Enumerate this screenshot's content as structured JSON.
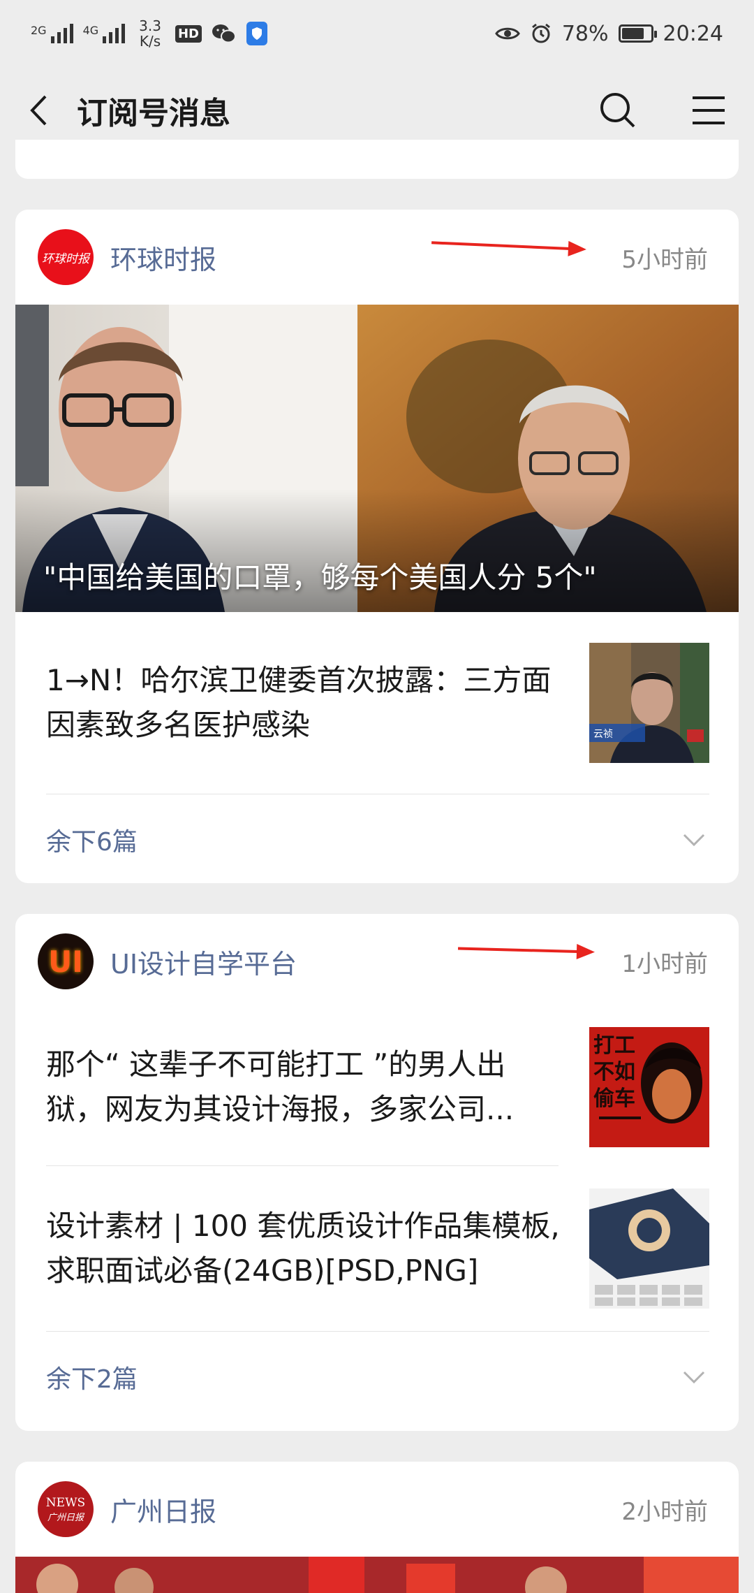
{
  "status_bar": {
    "network1": "2G",
    "network2": "4G",
    "speed_value": "3.3",
    "speed_unit": "K/s",
    "hd": "HD",
    "battery_percent": "78%",
    "battery_level": 0.78,
    "time": "20:24"
  },
  "nav": {
    "title": "订阅号消息"
  },
  "cards": [
    {
      "source": "环球时报",
      "logo_text": "环球时报",
      "time": "5小时前",
      "hero_caption": "\"中国给美国的口罩，够每个美国人分 5个\"",
      "articles": [
        {
          "title": "1→N！哈尔滨卫健委首次披露：三方面因素致多名医护感染",
          "thumb_caption": "云祯"
        }
      ],
      "more": "余下6篇"
    },
    {
      "source": "UI设计自学平台",
      "logo_text": "UI",
      "time": "1小时前",
      "articles": [
        {
          "title": "那个“ 这辈子不可能打工 ”的男人出狱，网友为其设计海报，多家公司...",
          "thumb_caption": "打工不如偷车"
        },
        {
          "title": "设计素材 | 100 套优质设计作品集模板,求职面试必备(24GB)[PSD,PNG]"
        }
      ],
      "more": "余下2篇"
    },
    {
      "source": "广州日报",
      "logo_text": "NEWS",
      "logo_sub": "广州日报",
      "time": "2小时前"
    }
  ]
}
